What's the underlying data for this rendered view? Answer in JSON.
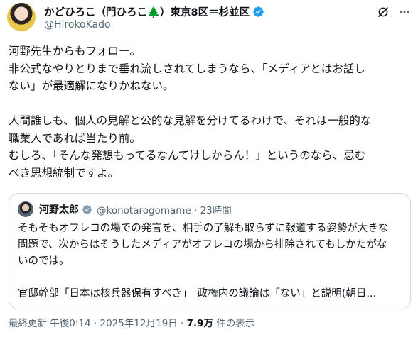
{
  "author": {
    "name": "かどひろこ（門ひろこ🌲）東京8区＝杉並区",
    "handle": "@HirokoKado"
  },
  "tweet": {
    "lines": [
      "河野先生からもフォロー。",
      "非公式なやりとりまで垂れ流しされてしまうなら、「メディアとはお話し",
      "ない」が最適解になりかねない。",
      "",
      "人間誰しも、個人の見解と公的な見解を分けてるわけで、それは一般的な",
      "職業人であれば当たり前。",
      "むしろ、「そんな発想もってるなんてけしからん！」というのなら、忌む",
      "べき思想統制ですよ。"
    ]
  },
  "quote": {
    "name": "河野太郎",
    "handle_time": "@konotarogomame · 23時間",
    "lines": [
      "そもそもオフレコの場での発言を、相手の了解も取らずに報道する姿勢が大きな",
      "問題で、次からはそうしたメディアがオフレコの場から排除されてもしかたがな",
      "いのでは。",
      "",
      "官邸幹部「日本は核兵器保有すべき」　政権内の議論は「ない」と説明(朝日..."
    ]
  },
  "meta": {
    "updated": "最終更新 午後0:14 · 2025年12月19日 · ",
    "views": "7.9万",
    "views_suffix": " 件の表示"
  },
  "colors": {
    "verified": "#1d9bf0",
    "text": "#0f1419",
    "secondary": "#536471",
    "border": "#cfd9de"
  },
  "icons": {
    "grok": "grok-icon",
    "more": "more-icon",
    "verified": "verified-badge-icon"
  }
}
